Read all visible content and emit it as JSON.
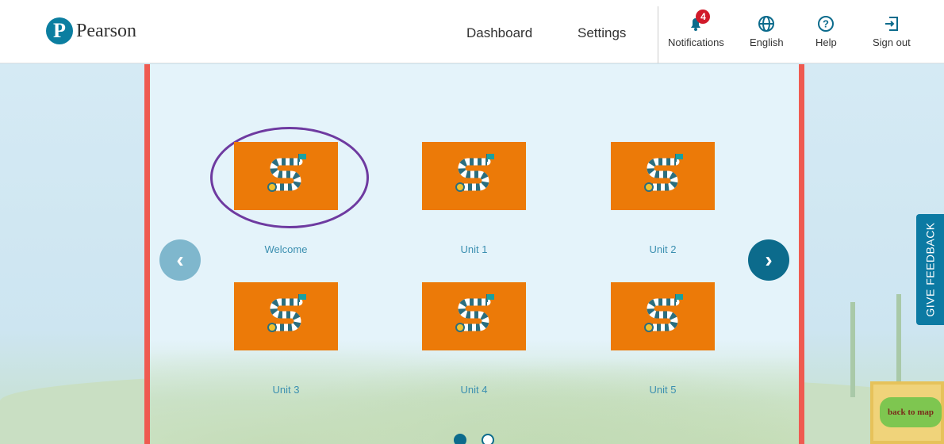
{
  "header": {
    "brand": "Pearson",
    "brand_mark": "P",
    "nav": {
      "dashboard": "Dashboard",
      "settings": "Settings"
    },
    "utilities": {
      "notifications": {
        "label": "Notifications",
        "count": "4",
        "icon": "bell-icon"
      },
      "language": {
        "label": "English",
        "icon": "globe-icon"
      },
      "help": {
        "label": "Help",
        "icon": "help-icon"
      },
      "signout": {
        "label": "Sign out",
        "icon": "sign-out-icon"
      }
    }
  },
  "units": [
    {
      "label": "Welcome",
      "icon": "board-game-path-icon"
    },
    {
      "label": "Unit 1",
      "icon": "board-game-path-icon"
    },
    {
      "label": "Unit 2",
      "icon": "board-game-path-icon"
    },
    {
      "label": "Unit 3",
      "icon": "board-game-path-icon"
    },
    {
      "label": "Unit 4",
      "icon": "board-game-path-icon"
    },
    {
      "label": "Unit 5",
      "icon": "board-game-path-icon"
    }
  ],
  "pager": {
    "pages": 2,
    "current": 1
  },
  "feedback": {
    "label": "GIVE FEEDBACK"
  },
  "back_to_map": {
    "label": "back to map"
  },
  "colors": {
    "tile": "#ec7a08",
    "panel_border": "#ef5a50",
    "accent": "#0c6b8c",
    "annotation": "#6e3aa0"
  }
}
